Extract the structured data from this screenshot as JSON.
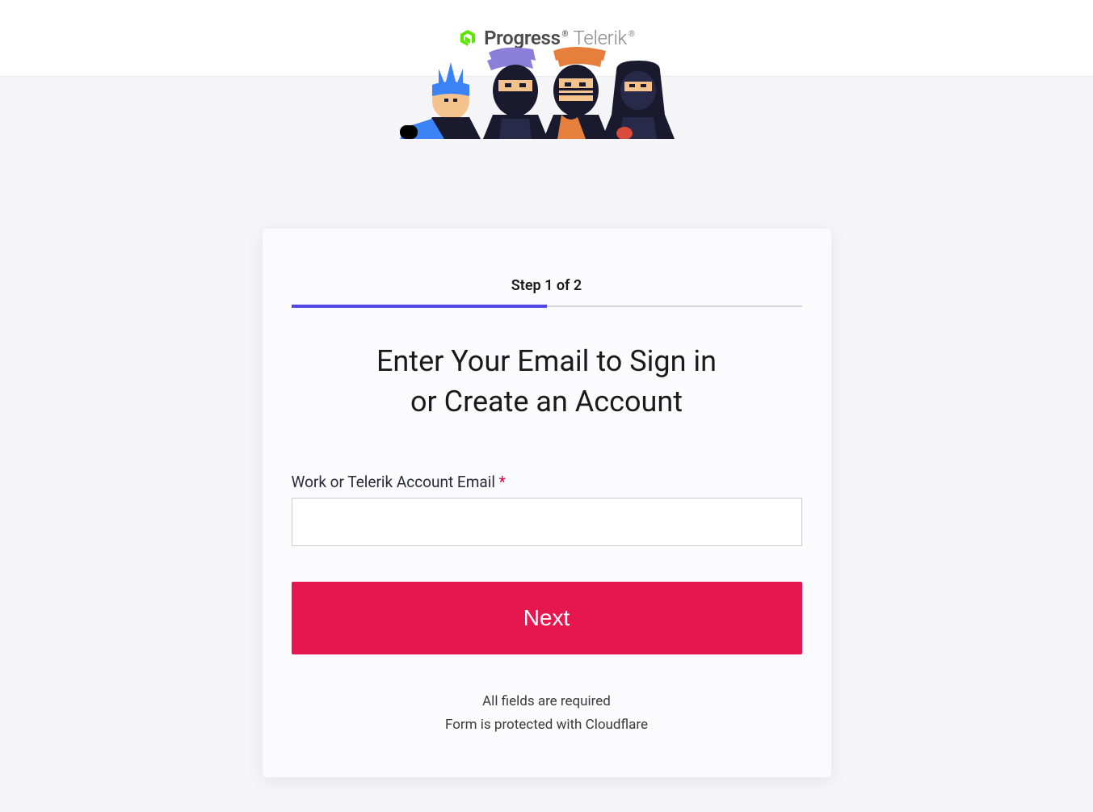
{
  "header": {
    "brand_primary": "Progress",
    "brand_secondary": "Telerik"
  },
  "card": {
    "step_label": "Step 1 of 2",
    "heading_line1": "Enter Your Email to Sign in",
    "heading_line2": "or Create an Account",
    "email_label": "Work or Telerik Account Email",
    "required_mark": "*",
    "email_value": "",
    "next_label": "Next",
    "footer_line1": "All fields are required",
    "footer_line2": "Form is protected with Cloudflare"
  },
  "colors": {
    "accent": "#4f46e5",
    "primary_button": "#e6174f",
    "brand_green": "#5ce500"
  }
}
